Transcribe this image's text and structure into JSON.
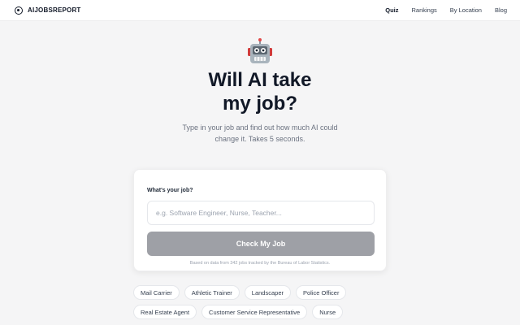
{
  "brand": {
    "name": "AIJOBSREPORT",
    "icon": "target-icon"
  },
  "nav": {
    "links": [
      {
        "label": "Quiz",
        "active": true
      },
      {
        "label": "Rankings",
        "active": false
      },
      {
        "label": "By Location",
        "active": false
      },
      {
        "label": "Blog",
        "active": false
      }
    ]
  },
  "hero": {
    "icon": "robot-icon",
    "title_line1": "Will AI take",
    "title_line2": "my job?",
    "subtitle_line1": "Type in your job and find out how much AI could",
    "subtitle_line2": "change it. Takes 5 seconds."
  },
  "form": {
    "label": "What's your job?",
    "placeholder": "e.g. Software Engineer, Nurse, Teacher...",
    "value": "",
    "button_label": "Check My Job",
    "footnote": "Based on data from 342 jobs tracked by the Bureau of Labor Statistics."
  },
  "suggestions": [
    "Mail Carrier",
    "Athletic Trainer",
    "Landscaper",
    "Police Officer",
    "Real Estate Agent",
    "Customer Service Representative",
    "Nurse"
  ],
  "colors": {
    "background": "#f5f5f6",
    "button_disabled": "#9ea0a6",
    "title": "#111827"
  }
}
